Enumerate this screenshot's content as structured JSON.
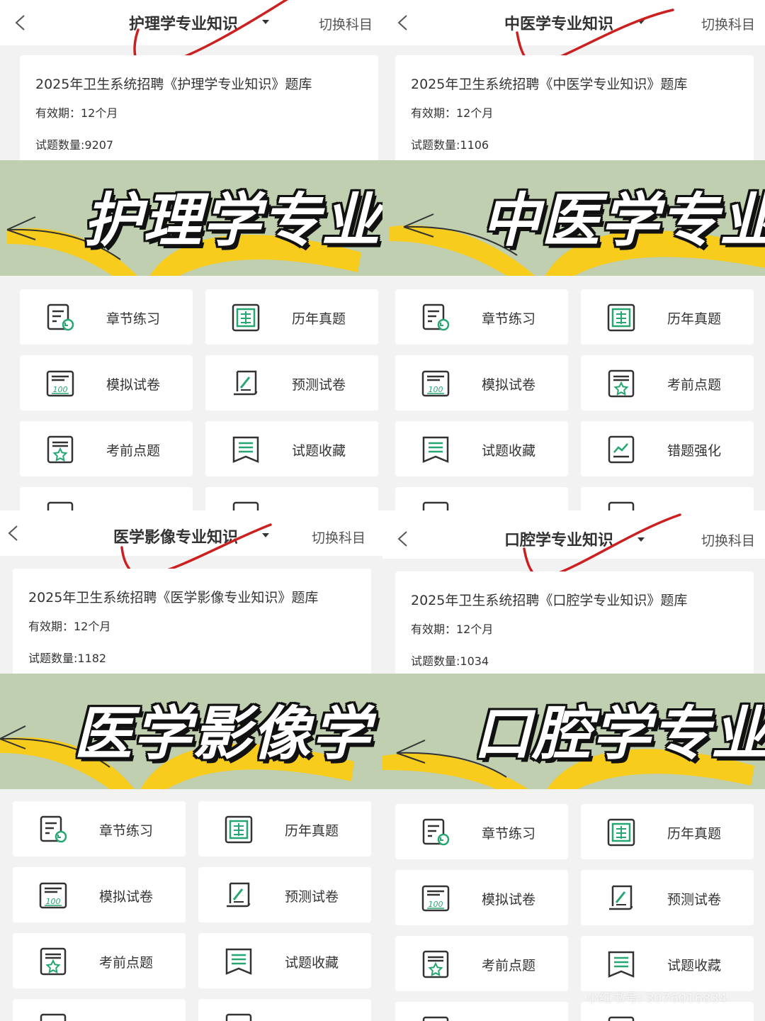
{
  "colors": {
    "accent": "#26a671",
    "banner_bg": "#bfcfb0",
    "arrow_yellow": "#f7cc1c",
    "check_red": "#cc2020"
  },
  "panels": [
    {
      "subject": "护理学专业知识",
      "switch_label": "切换科目",
      "bank_title": "2025年卫生系统招聘《护理学专业知识》题库",
      "validity": "有效期：12个月",
      "count": "试题数量:9207",
      "banner_text": "护理学专业",
      "tiles": [
        {
          "label": "章节练习",
          "icon": "chapter-practice-icon"
        },
        {
          "label": "历年真题",
          "icon": "past-exam-icon"
        },
        {
          "label": "模拟试卷",
          "icon": "mock-paper-icon"
        },
        {
          "label": "预测试卷",
          "icon": "forecast-paper-icon"
        },
        {
          "label": "考前点题",
          "icon": "key-points-icon"
        },
        {
          "label": "试题收藏",
          "icon": "favorites-icon"
        }
      ]
    },
    {
      "subject": "中医学专业知识",
      "switch_label": "切换科目",
      "bank_title": "2025年卫生系统招聘《中医学专业知识》题库",
      "validity": "有效期：12个月",
      "count": "试题数量:1106",
      "banner_text": "中医学专业",
      "tiles": [
        {
          "label": "章节练习",
          "icon": "chapter-practice-icon"
        },
        {
          "label": "历年真题",
          "icon": "past-exam-icon"
        },
        {
          "label": "模拟试卷",
          "icon": "mock-paper-icon"
        },
        {
          "label": "考前点题",
          "icon": "key-points-icon"
        },
        {
          "label": "试题收藏",
          "icon": "favorites-icon"
        },
        {
          "label": "错题强化",
          "icon": "mistakes-icon"
        }
      ]
    },
    {
      "subject": "医学影像专业知识",
      "switch_label": "切换科目",
      "bank_title": "2025年卫生系统招聘《医学影像专业知识》题库",
      "validity": "有效期：12个月",
      "count": "试题数量:1182",
      "banner_text": "医学影像学",
      "tiles": [
        {
          "label": "章节练习",
          "icon": "chapter-practice-icon"
        },
        {
          "label": "历年真题",
          "icon": "past-exam-icon"
        },
        {
          "label": "模拟试卷",
          "icon": "mock-paper-icon"
        },
        {
          "label": "预测试卷",
          "icon": "forecast-paper-icon"
        },
        {
          "label": "考前点题",
          "icon": "key-points-icon"
        },
        {
          "label": "试题收藏",
          "icon": "favorites-icon"
        }
      ]
    },
    {
      "subject": "口腔学专业知识",
      "switch_label": "切换科目",
      "bank_title": "2025年卫生系统招聘《口腔学专业知识》题库",
      "validity": "有效期：12个月",
      "count": "试题数量:1034",
      "banner_text": "口腔学专业",
      "tiles": [
        {
          "label": "章节练习",
          "icon": "chapter-practice-icon"
        },
        {
          "label": "历年真题",
          "icon": "past-exam-icon"
        },
        {
          "label": "模拟试卷",
          "icon": "mock-paper-icon"
        },
        {
          "label": "预测试卷",
          "icon": "forecast-paper-icon"
        },
        {
          "label": "考前点题",
          "icon": "key-points-icon"
        },
        {
          "label": "试题收藏",
          "icon": "favorites-icon"
        }
      ]
    }
  ],
  "watermark": {
    "text": "小红书号: 3076016834",
    "logo": "小红书"
  }
}
